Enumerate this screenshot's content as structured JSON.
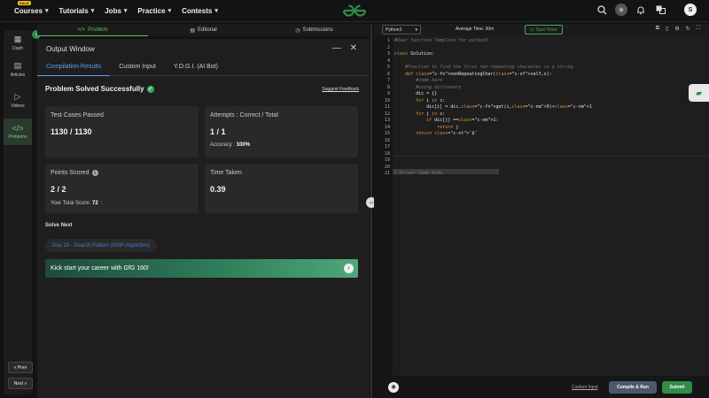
{
  "nav": {
    "sale_badge": "SALE",
    "items": [
      {
        "label": "Courses"
      },
      {
        "label": "Tutorials"
      },
      {
        "label": "Jobs"
      },
      {
        "label": "Practice"
      },
      {
        "label": "Contests"
      }
    ],
    "avatar_letter": "S"
  },
  "rail": {
    "items": [
      {
        "label": "Dash",
        "icon": "grid-icon"
      },
      {
        "label": "Articles",
        "icon": "article-icon"
      },
      {
        "label": "Videos",
        "icon": "video-icon"
      },
      {
        "label": "Problems",
        "icon": "code-icon"
      }
    ],
    "prev_label": "« Prev",
    "next_label": "Next »"
  },
  "problem_tabs": [
    {
      "label": "Problem",
      "icon": "</>"
    },
    {
      "label": "Editorial",
      "icon": "▤"
    },
    {
      "label": "Submissions",
      "icon": "◷"
    }
  ],
  "output": {
    "title": "Output Window",
    "tabs": [
      "Compilation Results",
      "Custom Input",
      "Y.O.G.I. (AI Bot)"
    ],
    "status": "Problem Solved Successfully",
    "suggest": "Suggest Feedback",
    "cards": {
      "tests_label": "Test Cases Passed",
      "tests_value": "1130 / 1130",
      "attempts_label": "Attempts : Correct / Total",
      "attempts_value": "1 / 1",
      "accuracy_label": "Accuracy : ",
      "accuracy_value": "100%",
      "points_label": "Points Scored",
      "points_value": "2 / 2",
      "total_label": "Your Total Score: ",
      "total_value": "72",
      "time_label": "Time Taken",
      "time_value": "0.39"
    },
    "solve_next": "Solve Next",
    "next_problem": "Day 18 - Search Pattern (KMP-Algorithm)",
    "banner": "Kick start your career with GfG 160!"
  },
  "editor": {
    "language": "Python3",
    "avg_time": "Average Time: 30m",
    "timer": "Start Timer",
    "line_numbers": [
      "1",
      "2",
      "3",
      "4",
      "5",
      "6",
      "7",
      "8",
      "9",
      "10",
      "11",
      "12",
      "13",
      "14",
      "15",
      "16",
      "17",
      "18",
      "19",
      "20",
      "21"
    ],
    "code": [
      "#User function Template for python3",
      "",
      "class Solution:",
      "",
      "    #Function to find the first non-repeating character in a string.",
      "    def nonRepeatingChar(self,s):",
      "        #code here",
      "        #using dictionary",
      "        dic = {}",
      "        for i in s:",
      "            dic[i] = dic.get(i,0)+1",
      "        for j in s:",
      "            if dic[j] ==1:",
      "                return j",
      "        return '$'",
      "",
      "",
      "",
      "",
      "",
      "} Driver Code Ends"
    ],
    "custom_input": "Custom Input",
    "compile": "Compile & Run",
    "submit": "Submit"
  }
}
